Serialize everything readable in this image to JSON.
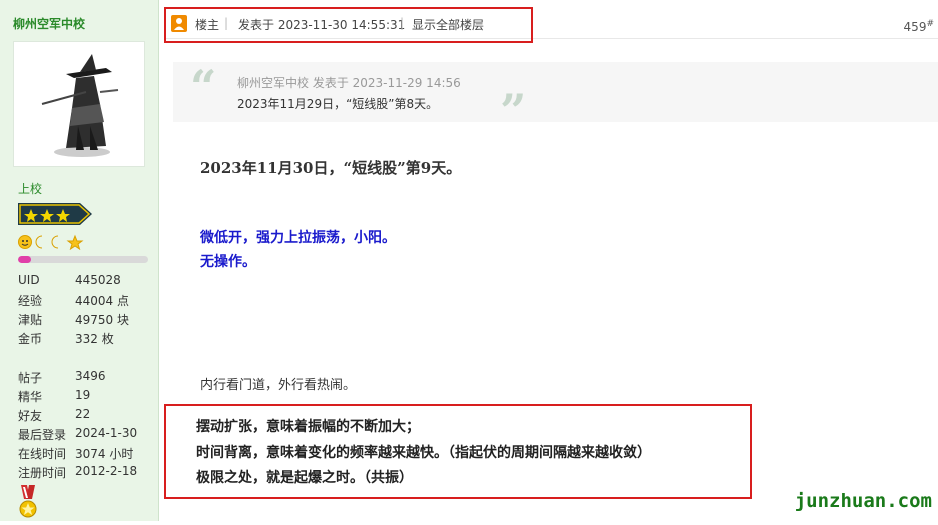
{
  "sidebar": {
    "username": "柳州空军中校",
    "rank": "上校",
    "level_progress": 0.1,
    "stats": [
      {
        "label": "UID",
        "value": "445028"
      },
      {
        "label": "经验",
        "value": "44004 点"
      },
      {
        "label": "津贴",
        "value": "49750 块"
      },
      {
        "label": "金币",
        "value": "332 枚"
      },
      {
        "label": "帖子",
        "value": "3496"
      },
      {
        "label": "精华",
        "value": "19"
      },
      {
        "label": "好友",
        "value": "22"
      },
      {
        "label": "最后登录",
        "value": "2024-1-30"
      },
      {
        "label": "在线时间",
        "value": "3074 小时"
      },
      {
        "label": "注册时间",
        "value": "2012-2-18"
      }
    ]
  },
  "header": {
    "owner_label": "楼主",
    "posted_at": "发表于 2023-11-30 14:55:31",
    "show_all": "显示全部楼层",
    "floor_number": "459",
    "floor_suffix": "#"
  },
  "quote": {
    "meta": "柳州空军中校 发表于 2023-11-29 14:56",
    "text": "2023年11月29日，“短线股”第8天。"
  },
  "post": {
    "title": "2023年11月30日，“短线股”第9天。",
    "blue_lines": [
      "微低开，强力上拉振荡，小阳。",
      "无操作。"
    ],
    "saying": "内行看门道，外行看热闹。",
    "highlight_lines": [
      "摆动扩张，意味着振幅的不断加大；",
      "时间背离，意味着变化的频率越来越快。（指起伏的周期间隔越来越收敛）",
      "极限之处，就是起爆之时。（共振）"
    ]
  },
  "watermark": "junzhuan.com",
  "colors": {
    "username_green": "#2a8a2a",
    "highlight_red": "#d81e1e",
    "blue_text": "#1a1acc",
    "progress_pink": "#e040a8",
    "owner_orange": "#f08a00"
  }
}
